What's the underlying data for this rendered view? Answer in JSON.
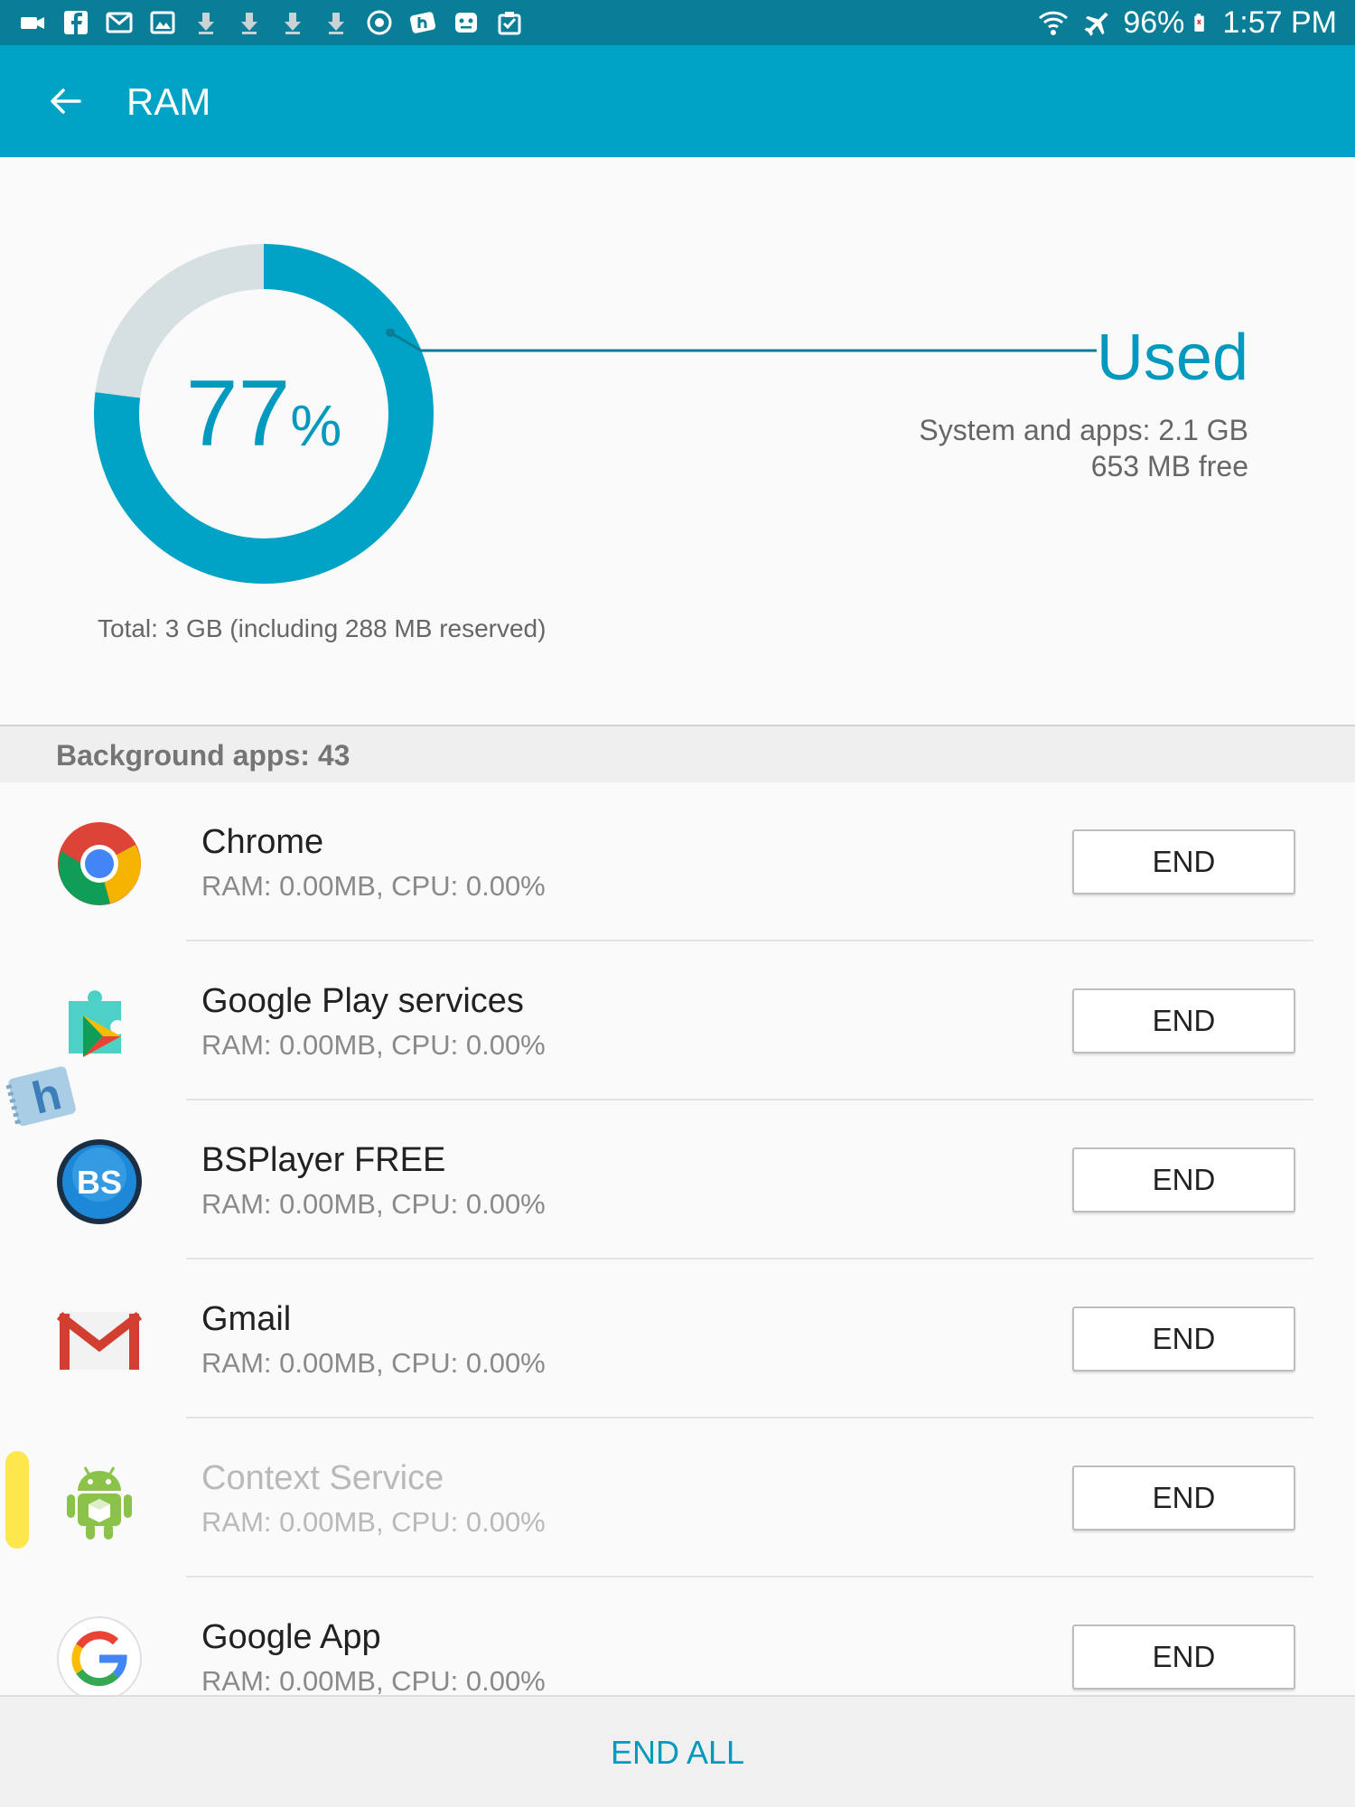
{
  "status_bar": {
    "notification_icons": [
      "video-icon",
      "facebook-icon",
      "gmail-icon",
      "gallery-icon",
      "download-icon",
      "download-icon",
      "download-icon",
      "download-icon",
      "sync-icon",
      "hipchat-icon",
      "game-icon",
      "clipboard-icon"
    ],
    "battery": "96%",
    "time": "1:57 PM"
  },
  "app_bar": {
    "title": "RAM"
  },
  "summary": {
    "percent": "77",
    "percent_sign": "%",
    "used_fraction": 0.77,
    "used_label": "Used",
    "system_apps": "System and apps: 2.1 GB",
    "free": "653 MB free",
    "total": "Total: 3 GB (including 288 MB reserved)"
  },
  "background_header": "Background apps: 43",
  "apps": [
    {
      "name": "Chrome",
      "stats": "RAM: 0.00MB, CPU: 0.00%",
      "icon": "chrome-icon",
      "button": "END"
    },
    {
      "name": "Google Play services",
      "stats": "RAM: 0.00MB, CPU: 0.00%",
      "icon": "play-services-icon",
      "button": "END"
    },
    {
      "name": "BSPlayer FREE",
      "stats": "RAM: 0.00MB, CPU: 0.00%",
      "icon": "bsplayer-icon",
      "button": "END"
    },
    {
      "name": "Gmail",
      "stats": "RAM: 0.00MB, CPU: 0.00%",
      "icon": "gmail-icon",
      "button": "END"
    },
    {
      "name": "Context Service",
      "stats": "RAM: 0.00MB, CPU: 0.00%",
      "icon": "android-icon",
      "button": "END"
    },
    {
      "name": "Google App",
      "stats": "RAM: 0.00MB, CPU: 0.00%",
      "icon": "google-icon",
      "button": "END"
    }
  ],
  "bsplayer_logo_text": "BS",
  "badge_letter": "h",
  "end_all_label": "END ALL",
  "colors": {
    "status_bar": "#0a7e97",
    "app_bar": "#00a3c6",
    "accent": "#0199bd",
    "donut_remaining": "#d6dfe1"
  }
}
